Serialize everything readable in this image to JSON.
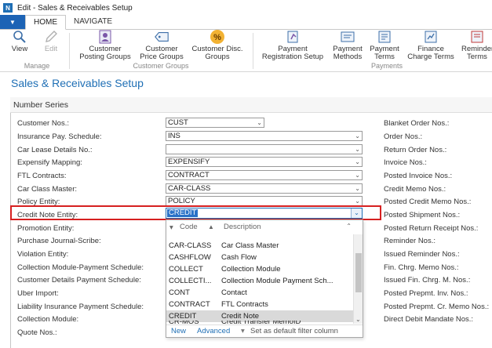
{
  "window": {
    "title": "Edit - Sales & Receivables Setup"
  },
  "tabs": [
    "HOME",
    "NAVIGATE"
  ],
  "ribbon": {
    "view": "View",
    "edit": "Edit",
    "customer_posting_groups": [
      "Customer",
      "Posting Groups"
    ],
    "customer_price_groups": [
      "Customer",
      "Price Groups"
    ],
    "customer_disc_groups": [
      "Customer Disc.",
      "Groups"
    ],
    "payment_registration_setup": [
      "Payment",
      "Registration Setup"
    ],
    "payment_methods": [
      "Payment",
      "Methods"
    ],
    "payment_terms": [
      "Payment",
      "Terms"
    ],
    "finance_charge_terms": [
      "Finance",
      "Charge Terms"
    ],
    "reminder_terms": [
      "Reminder",
      "Terms"
    ],
    "groups": {
      "manage": "Manage",
      "customer_groups": "Customer Groups",
      "payments": "Payments"
    }
  },
  "page": {
    "title": "Sales & Receivables Setup",
    "section": "Number Series"
  },
  "fields": [
    {
      "label": "Customer Nos.:",
      "value": "CUST"
    },
    {
      "label": "Insurance Pay. Schedule:",
      "value": "INS"
    },
    {
      "label": "Car Lease Details No.:",
      "value": ""
    },
    {
      "label": "Expensify Mapping:",
      "value": "EXPENSIFY"
    },
    {
      "label": "FTL Contracts:",
      "value": "CONTRACT"
    },
    {
      "label": "Car Class Master:",
      "value": "CAR-CLASS"
    },
    {
      "label": "Policy Entity:",
      "value": "POLICY"
    },
    {
      "label": "Credit Note Entity:",
      "value": "CREDIT"
    },
    {
      "label": "Promotion Entity:",
      "value": ""
    },
    {
      "label": "Purchase Journal-Scribe:",
      "value": ""
    },
    {
      "label": "Violation Entity:",
      "value": ""
    },
    {
      "label": "Collection Module-Payment Schedule:",
      "value": ""
    },
    {
      "label": "Customer Details Payment Schedule:",
      "value": ""
    },
    {
      "label": "Uber Import:",
      "value": ""
    },
    {
      "label": "Liability Insurance Payment Schedule:",
      "value": ""
    },
    {
      "label": "Collection Module:",
      "value": ""
    },
    {
      "label": "Quote Nos.:",
      "value": ""
    }
  ],
  "right_fields": [
    "Blanket Order Nos.:",
    "Order Nos.:",
    "Return Order Nos.:",
    "Invoice Nos.:",
    "Posted Invoice Nos.:",
    "Credit Memo Nos.:",
    "Posted Credit Memo Nos.:",
    "Posted Shipment Nos.:",
    "Posted Return Receipt Nos.:",
    "Reminder Nos.:",
    "Issued Reminder Nos.:",
    "Fin. Chrg. Memo Nos.:",
    "Issued Fin. Chrg. M. Nos.:",
    "Posted Prepmt. Inv. Nos.:",
    "Posted Prepmt. Cr. Memo Nos.:",
    "Direct Debit Mandate Nos.:"
  ],
  "lookup": {
    "col_code": "Code",
    "col_description": "Description",
    "rows": [
      {
        "code": "CAR-CLASS",
        "description": "Car Class Master"
      },
      {
        "code": "CASHFLOW",
        "description": "Cash Flow"
      },
      {
        "code": "COLLECT",
        "description": "Collection Module"
      },
      {
        "code": "COLLECTI...",
        "description": "Collection Module Payment Sch..."
      },
      {
        "code": "CONT",
        "description": "Contact"
      },
      {
        "code": "CONTRACT",
        "description": "FTL Contracts"
      },
      {
        "code": "CREDIT",
        "description": "Credit Note"
      },
      {
        "code": "CR-MOS",
        "description": "Credit Transfer MemoID"
      }
    ],
    "footer_new": "New",
    "footer_advanced": "Advanced",
    "footer_default": "Set as default filter column"
  }
}
